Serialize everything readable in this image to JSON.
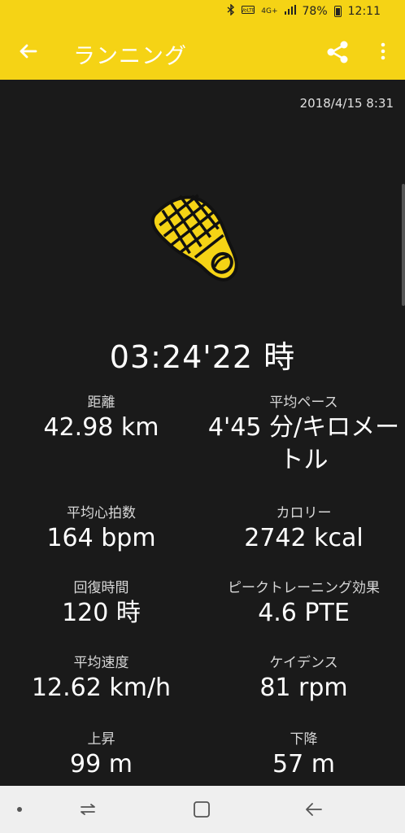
{
  "status_bar": {
    "battery": "78%",
    "time": "12:11",
    "network": "4G+",
    "icons": [
      "bluetooth-icon",
      "volte-icon",
      "signal-icon",
      "battery-icon"
    ]
  },
  "app_bar": {
    "title": "ランニング",
    "icons": [
      "back-arrow-icon",
      "share-icon",
      "more-vert-icon"
    ]
  },
  "workout": {
    "date": "2018/4/15 8:31",
    "duration": "03:24'22 時",
    "icon": "running-shoe-icon",
    "accent_color": "#f5d315"
  },
  "stats": [
    {
      "label": "距離",
      "value": "42.98 km"
    },
    {
      "label": "平均ペース",
      "value": "4'45 分/キロメートル"
    },
    {
      "label": "平均心拍数",
      "value": "164 bpm"
    },
    {
      "label": "カロリー",
      "value": "2742 kcal"
    },
    {
      "label": "回復時間",
      "value": "120 時"
    },
    {
      "label": "ピークトレーニング効果",
      "value": "4.6 PTE"
    },
    {
      "label": "平均速度",
      "value": "12.62 km/h"
    },
    {
      "label": "ケイデンス",
      "value": "81 rpm"
    },
    {
      "label": "上昇",
      "value": "99 m"
    },
    {
      "label": "下降",
      "value": "57 m"
    }
  ],
  "nav_bar": {
    "icons": [
      "dot-indicator-icon",
      "recent-apps-icon",
      "home-icon",
      "back-icon"
    ]
  }
}
